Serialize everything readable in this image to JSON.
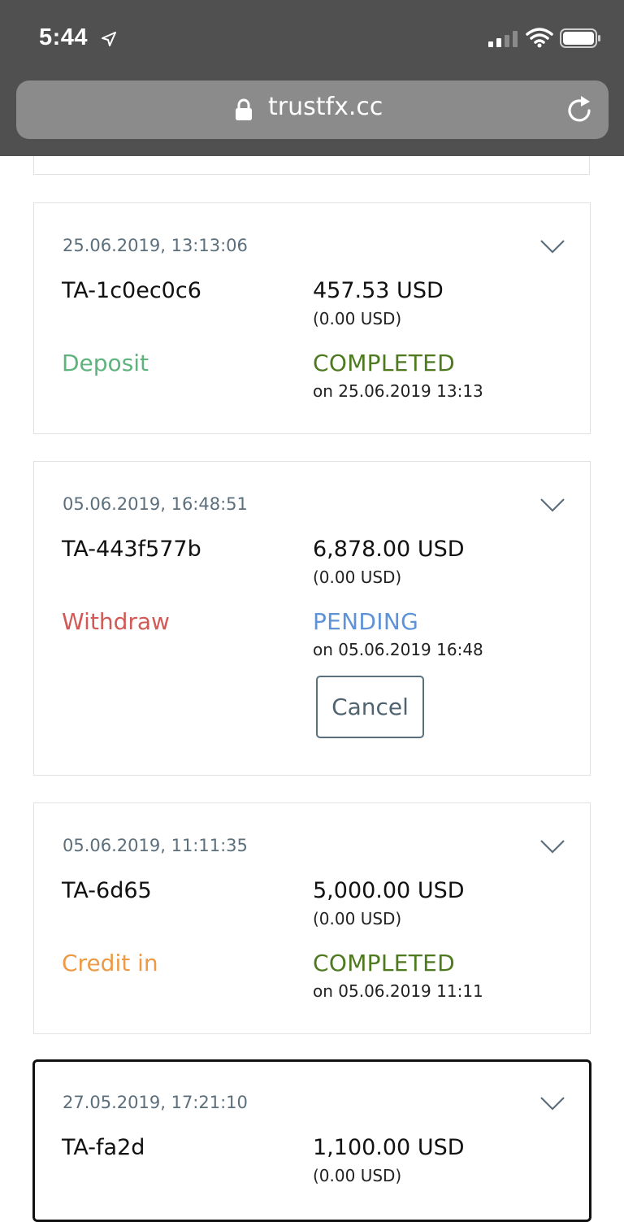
{
  "status_bar": {
    "time": "5:44"
  },
  "browser": {
    "url": "trustfx.cc"
  },
  "colors": {
    "date_text": "#5c6f7c",
    "deposit": "#5fb37d",
    "withdraw": "#d25a56",
    "credit_in": "#ec9a45",
    "completed": "#4e7a1f",
    "pending": "#5f93d8"
  },
  "transactions": [
    {
      "date": "25.06.2019, 13:13:06",
      "id": "TA-1c0ec0c6",
      "amount": "457.53 USD",
      "fee": "(0.00 USD)",
      "type": "Deposit",
      "status": "COMPLETED",
      "status_date": "on 25.06.2019 13:13"
    },
    {
      "date": "05.06.2019, 16:48:51",
      "id": "TA-443f577b",
      "amount": "6,878.00 USD",
      "fee": "(0.00 USD)",
      "type": "Withdraw",
      "status": "PENDING",
      "status_date": "on 05.06.2019 16:48",
      "cancel_label": "Cancel"
    },
    {
      "date": "05.06.2019, 11:11:35",
      "id": "TA-6d65",
      "amount": "5,000.00 USD",
      "fee": "(0.00 USD)",
      "type": "Credit in",
      "status": "COMPLETED",
      "status_date": "on 05.06.2019 11:11"
    },
    {
      "date": "27.05.2019, 17:21:10",
      "id": "TA-fa2d",
      "amount": "1,100.00 USD",
      "fee": "(0.00 USD)"
    }
  ]
}
